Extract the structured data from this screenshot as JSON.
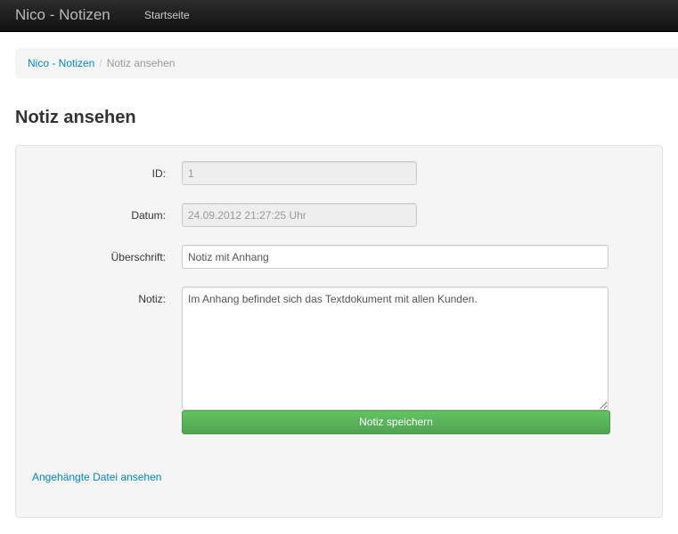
{
  "navbar": {
    "brand": "Nico - Notizen",
    "links": [
      "Startseite"
    ]
  },
  "breadcrumb": {
    "home": "Nico - Notizen",
    "separator": "/",
    "current": "Notiz ansehen"
  },
  "page_title": "Notiz ansehen",
  "form": {
    "id_label": "ID:",
    "id_value": "1",
    "date_label": "Datum:",
    "date_value": "24.09.2012 21:27:25 Uhr",
    "title_label": "Überschrift:",
    "title_value": "Notiz mit Anhang",
    "note_label": "Notiz:",
    "note_value": "Im Anhang befindet sich das Textdokument mit allen Kunden.",
    "save_label": "Notiz speichern"
  },
  "attachment_link": "Angehängte Datei ansehen",
  "colors": {
    "navbar": "#1b1b1b",
    "link": "#0088cc",
    "save_button": "#5bb75b"
  }
}
